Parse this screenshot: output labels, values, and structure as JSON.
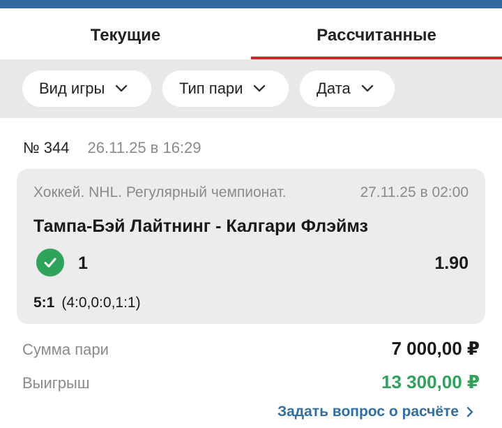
{
  "tabs": [
    {
      "label": "Текущие",
      "active": false
    },
    {
      "label": "Рассчитанные",
      "active": true
    }
  ],
  "filters": [
    {
      "label": "Вид игры",
      "icon": "chevron-down-icon"
    },
    {
      "label": "Тип пари",
      "icon": "chevron-down-icon"
    },
    {
      "label": "Дата",
      "icon": "chevron-down-icon"
    }
  ],
  "bet": {
    "number": "№ 344",
    "placed_at": "26.11.25 в 16:29",
    "event": {
      "league": "Хоккей. NHL. Регулярный чемпионат.",
      "date": "27.11.25 в 02:00",
      "match": "Тампа-Бэй Лайтнинг - Калгари Флэймз",
      "outcome": "1",
      "odds": "1.90",
      "score": "5:1",
      "periods": "(4:0,0:0,1:1)",
      "status_icon": "check-circle-icon"
    },
    "stake_label": "Сумма пари",
    "stake_value": "7 000,00 ₽",
    "win_label": "Выигрыш",
    "win_value": "13 300,00 ₽",
    "ask_link": "Задать вопрос о расчёте"
  },
  "colors": {
    "topbar": "#2f6b9e",
    "active_tab_underline": "#cc2b2b",
    "win": "#2ea35a",
    "link": "#2f6fa8"
  }
}
